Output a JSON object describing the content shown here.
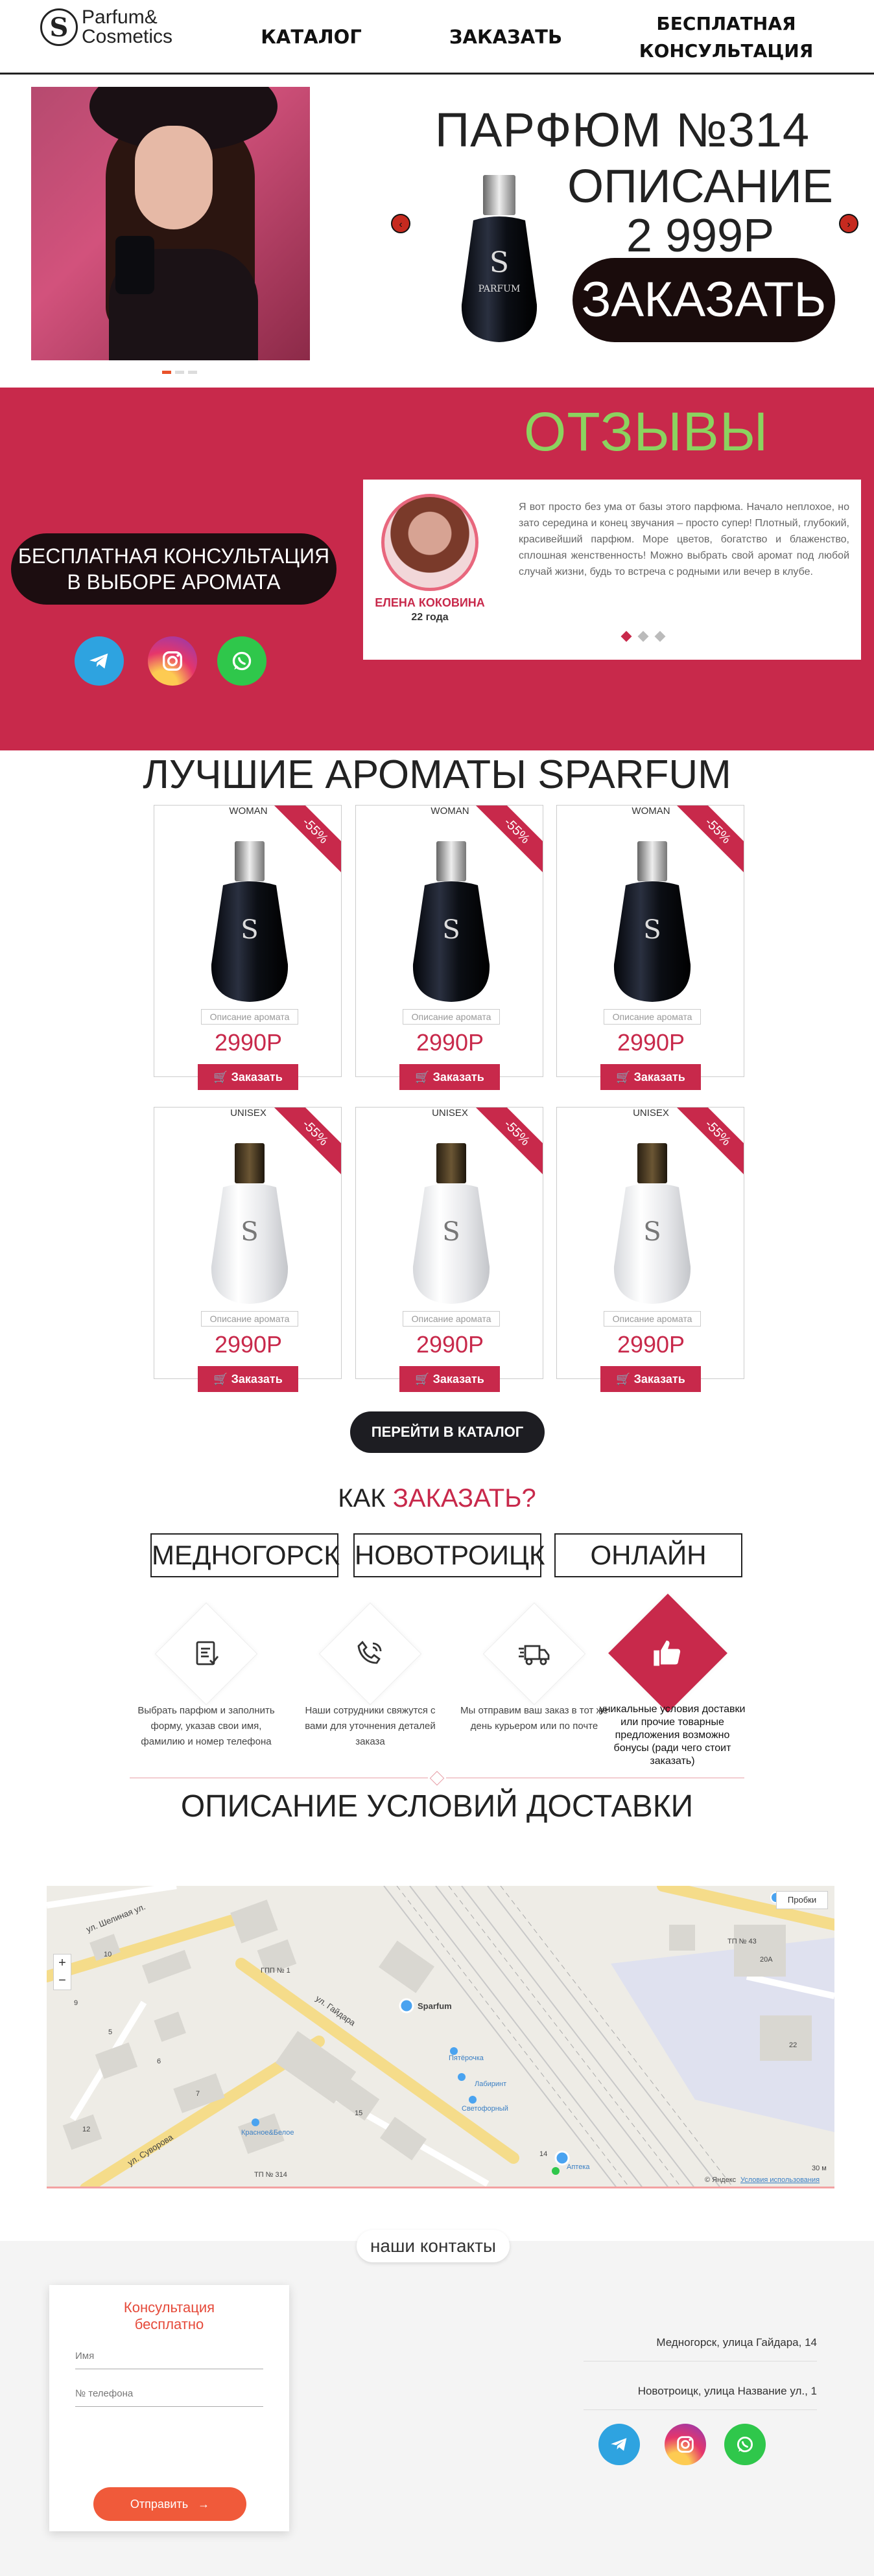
{
  "header": {
    "logo_text_1": "Parfum&",
    "logo_text_2": "Cosmetics",
    "nav": [
      "КАТАЛОГ",
      "ЗАКАЗАТЬ",
      "БЕСПЛАТНАЯ КОНСУЛЬТАЦИЯ"
    ]
  },
  "hero": {
    "title": "ПАРФЮМ №314",
    "description": "ОПИСАНИЕ",
    "price": "2 999Р",
    "order_label": "ЗАКАЗАТЬ",
    "bottle_brand": "PARFUM",
    "slide_count": 3,
    "active_slide": 1
  },
  "reviews": {
    "title": "ОТЗЫВЫ",
    "consult_label_1": "БЕСПЛАТНАЯ КОНСУЛЬТАЦИЯ",
    "consult_label_2": "В ВЫБОРЕ АРОМАТА",
    "name": "ЕЛЕНА КОКОВИНА",
    "age": "22 года",
    "text": "Я вот просто без ума от базы этого парфюма. Начало неплохое, но зато середина и конец звучания – просто супер! Плотный, глубокий, красивейший парфюм. Море цветов, богатство и блаженство, сплошная женственность! Можно выбрать свой аромат под любой случай жизни, будь то встреча с родными или вечер в клубе.",
    "slide_count": 3,
    "active_slide": 1
  },
  "products": {
    "title": "ЛУЧШИЕ АРОМАТЫ SPARFUM",
    "items": [
      {
        "gender": "WOMAN",
        "discount": "-55%",
        "desc": "Описание аромата",
        "price": "2990Р",
        "buy": "Заказать",
        "color": "dark"
      },
      {
        "gender": "WOMAN",
        "discount": "-55%",
        "desc": "Описание аромата",
        "price": "2990Р",
        "buy": "Заказать",
        "color": "dark"
      },
      {
        "gender": "WOMAN",
        "discount": "-55%",
        "desc": "Описание аромата",
        "price": "2990Р",
        "buy": "Заказать",
        "color": "dark"
      },
      {
        "gender": "UNISEX",
        "discount": "-55%",
        "desc": "Описание аромата",
        "price": "2990Р",
        "buy": "Заказать",
        "color": "light"
      },
      {
        "gender": "UNISEX",
        "discount": "-55%",
        "desc": "Описание аромата",
        "price": "2990Р",
        "buy": "Заказать",
        "color": "light"
      },
      {
        "gender": "UNISEX",
        "discount": "-55%",
        "desc": "Описание аромата",
        "price": "2990Р",
        "buy": "Заказать",
        "color": "light"
      }
    ],
    "catalog_button": "ПЕРЕЙТИ В КАТАЛОГ"
  },
  "how_to_order": {
    "title_plain": "КАК ",
    "title_accent": "ЗАКАЗАТЬ?",
    "cities": [
      "МЕДНОГОРСК",
      "НОВОТРОИЦК",
      "ОНЛАЙН"
    ],
    "steps": [
      "Выбрать парфюм и заполнить форму, указав свои имя, фамилию и номер телефона",
      "Наши сотрудники свяжутся с вами для уточнения деталей заказа",
      "Мы отправим ваш заказ в тот же день курьером или по почте",
      "уникальные условия доставки или прочие товарные предложения возможно бонусы (ради чего стоит заказать)"
    ],
    "delivery_title": "ОПИСАНИЕ УСЛОВИЙ ДОСТАВКИ"
  },
  "map": {
    "labels": [
      "ул. Шелиная ул.",
      "ул. Гайдара",
      "ул. Суворова",
      "Sparfum",
      "Пробки",
      "Лабиринт",
      "Пятёрочка",
      "Красное&Белое",
      "Светофорный",
      "Аптека",
      "ТП № 314",
      "ГПП № 1",
      "ТП № 43",
      "Яндекс",
      "Условия использования",
      "30 м",
      "14",
      "15",
      "20А",
      "22",
      "5",
      "6",
      "7",
      "9",
      "10",
      "12"
    ],
    "copyright": "© Яндекс"
  },
  "contacts": {
    "tag": "наши контакты",
    "form_title_1": "Консультация",
    "form_title_2": "бесплатно",
    "name_placeholder": "Имя",
    "phone_placeholder": "№ телефона",
    "send_label": "Отправить",
    "addresses": [
      "Медногорск, улица Гайдара, 14",
      "Новотроицк, улица Название ул., 1"
    ]
  },
  "colors": {
    "accent": "#c8294b",
    "reviews_title": "#8bd35f",
    "dark": "#1a0c0c",
    "send": "#f05a3a"
  }
}
